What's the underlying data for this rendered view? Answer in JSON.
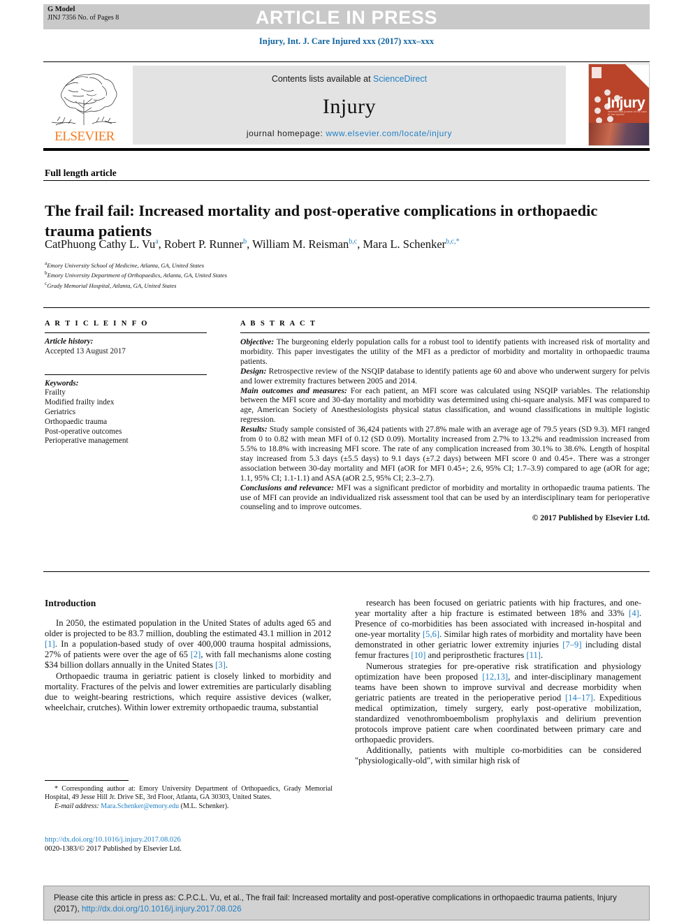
{
  "banner": {
    "g_model": "G Model",
    "g_model_sub": "JINJ 7356 No. of Pages 8",
    "article_in_press": "ARTICLE IN PRESS"
  },
  "journal_line": "Injury, Int. J. Care Injured xxx (2017) xxx–xxx",
  "masthead": {
    "contents_prefix": "Contents lists available at ",
    "sciencedirect": "ScienceDirect",
    "journal_name": "Injury",
    "homepage_prefix": "journal homepage: ",
    "homepage_url": "www.elsevier.com/locate/injury",
    "publisher": "ELSEVIER",
    "cover_title": "Injury",
    "cover_subtitle": "international journal of the care of the injured"
  },
  "article": {
    "type": "Full length article",
    "title": "The frail fail: Increased mortality and post-operative complications in orthopaedic trauma patients",
    "authors_html": "CatPhuong Cathy L. Vu<sup>a</sup>, Robert P. Runner<sup>b</sup>, William M. Reisman<sup>b,c</sup>, Mara L. Schenker<sup>b,c,</sup><sup>*</sup>",
    "affiliations": [
      {
        "marker": "a",
        "text": "Emory University School of Medicine, Atlanta, GA, United States"
      },
      {
        "marker": "b",
        "text": "Emory University Department of Orthopaedics, Atlanta, GA, United States"
      },
      {
        "marker": "c",
        "text": "Grady Memorial Hospital, Atlanta, GA, United States"
      }
    ]
  },
  "article_info": {
    "heading": "A R T I C L E   I N F O",
    "history_label": "Article history:",
    "history_value": "Accepted 13 August 2017",
    "keywords_label": "Keywords:",
    "keywords": [
      "Frailty",
      "Modified frailty index",
      "Geriatrics",
      "Orthopaedic trauma",
      "Post-operative outcomes",
      "Perioperative management"
    ]
  },
  "abstract": {
    "heading": "A B S T R A C T",
    "objective_label": "Objective:",
    "objective_text": " The burgeoning elderly population calls for a robust tool to identify patients with increased risk of mortality and morbidity. This paper investigates the utility of the MFI as a predictor of morbidity and mortality in orthopaedic trauma patients.",
    "design_label": "Design:",
    "design_text": " Retrospective review of the NSQIP database to identify patients age 60 and above who underwent surgery for pelvis and lower extremity fractures between 2005 and 2014.",
    "main_label": "Main outcomes and measures:",
    "main_text": " For each patient, an MFI score was calculated using NSQIP variables. The relationship between the MFI score and 30-day mortality and morbidity was determined using chi-square analysis. MFI was compared to age, American Society of Anesthesiologists physical status classification, and wound classifications in multiple logistic regression.",
    "results_label": "Results:",
    "results_text": " Study sample consisted of 36,424 patients with 27.8% male with an average age of 79.5 years (SD 9.3). MFI ranged from 0 to 0.82 with mean MFI of 0.12 (SD 0.09). Mortality increased from 2.7% to 13.2% and readmission increased from 5.5% to 18.8% with increasing MFI score. The rate of any complication increased from 30.1% to 38.6%. Length of hospital stay increased from 5.3 days (±5.5 days) to 9.1 days (±7.2 days) between MFI score 0 and 0.45+. There was a stronger association between 30-day mortality and MFI (aOR for MFI 0.45+; 2.6, 95% CI; 1.7–3.9) compared to age (aOR for age; 1.1, 95% CI; 1.1-1.1) and ASA (aOR 2.5, 95% CI; 2.3–2.7).",
    "conclusions_label": "Conclusions and relevance:",
    "conclusions_text": " MFI was a significant predictor of morbidity and mortality in orthopaedic trauma patients. The use of MFI can provide an individualized risk assessment tool that can be used by an interdisciplinary team for perioperative counseling and to improve outcomes.",
    "copyright": "© 2017 Published by Elsevier Ltd."
  },
  "introduction": {
    "heading": "Introduction",
    "left_paragraphs": [
      "In 2050, the estimated population in the United States of adults aged 65 and older is projected to be 83.7 million, doubling the estimated 43.1 million in 2012 [1]. In a population-based study of over 400,000 trauma hospital admissions, 27% of patients were over the age of 65 [2], with fall mechanisms alone costing $34 billion dollars annually in the United States [3].",
      "Orthopaedic trauma in geriatric patient is closely linked to morbidity and mortality. Fractures of the pelvis and lower extremities are particularly disabling due to weight-bearing restrictions, which require assistive devices (walker, wheelchair, crutches). Within lower extremity orthopaedic trauma, substantial"
    ],
    "right_paragraphs": [
      "research has been focused on geriatric patients with hip fractures, and one-year mortality after a hip fracture is estimated between 18% and 33% [4]. Presence of co-morbidities has been associated with increased in-hospital and one-year mortality [5,6]. Similar high rates of morbidity and mortality have been demonstrated in other geriatric lower extremity injuries [7–9] including distal femur fractures [10] and periprosthetic fractures [11].",
      "Numerous strategies for pre-operative risk stratification and physiology optimization have been proposed [12,13], and inter-disciplinary management teams have been shown to improve survival and decrease morbidity when geriatric patients are treated in the perioperative period [14–17]. Expeditious medical optimization, timely surgery, early post-operative mobilization, standardized venothromboembolism prophylaxis and delirium prevention protocols improve patient care when coordinated between primary care and orthopaedic providers.",
      "Additionally, patients with multiple co-morbidities can be considered \"physiologically-old\", with similar high risk of"
    ]
  },
  "footnotes": {
    "corresponding_marker": "*",
    "corresponding_text": " Corresponding author at: Emory University Department of Orthopaedics, Grady Memorial Hospital, 49 Jesse Hill Jr. Drive SE, 3rd Floor, Atlanta, GA 30303, United States.",
    "email_label": "E-mail address:",
    "email": "Mara.Schenker@emory.edu",
    "email_suffix": " (M.L. Schenker).",
    "doi_url": "http://dx.doi.org/10.1016/j.injury.2017.08.026",
    "issn_line": "0020-1383/© 2017 Published by Elsevier Ltd."
  },
  "cite_box": {
    "text_before": "Please cite this article in press as: C.P.C.L. Vu, et al., The frail fail: Increased mortality and post-operative complications in orthopaedic trauma patients, Injury (2017), ",
    "doi": "http://dx.doi.org/10.1016/j.injury.2017.08.026"
  },
  "colors": {
    "link": "#1f7fc4",
    "banner_bg": "#c9c9c9",
    "masthead_bg": "#e3e3e3",
    "elsevier_orange": "#f57c20",
    "cover_red": "#b9442a"
  }
}
